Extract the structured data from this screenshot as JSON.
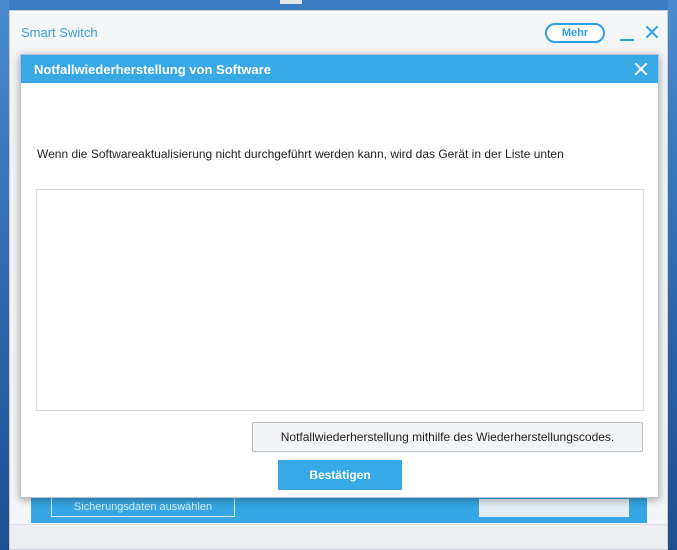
{
  "app": {
    "title": "Smart Switch",
    "more_label": "Mehr"
  },
  "background": {
    "left_button_label": "Sicherungsdaten auswählen"
  },
  "dialog": {
    "title": "Notfallwiederherstellung von Software",
    "message": "Wenn die Softwareaktualisierung nicht durchgeführt werden kann, wird das Gerät in der Liste unten",
    "device_list_items": [],
    "recovery_code_button_label": "Notfallwiederherstellung mithilfe des Wiederherstellungscodes.",
    "confirm_button_label": "Bestätigen"
  },
  "colors": {
    "accent": "#38a8e6",
    "title_text": "#3aa0df"
  }
}
